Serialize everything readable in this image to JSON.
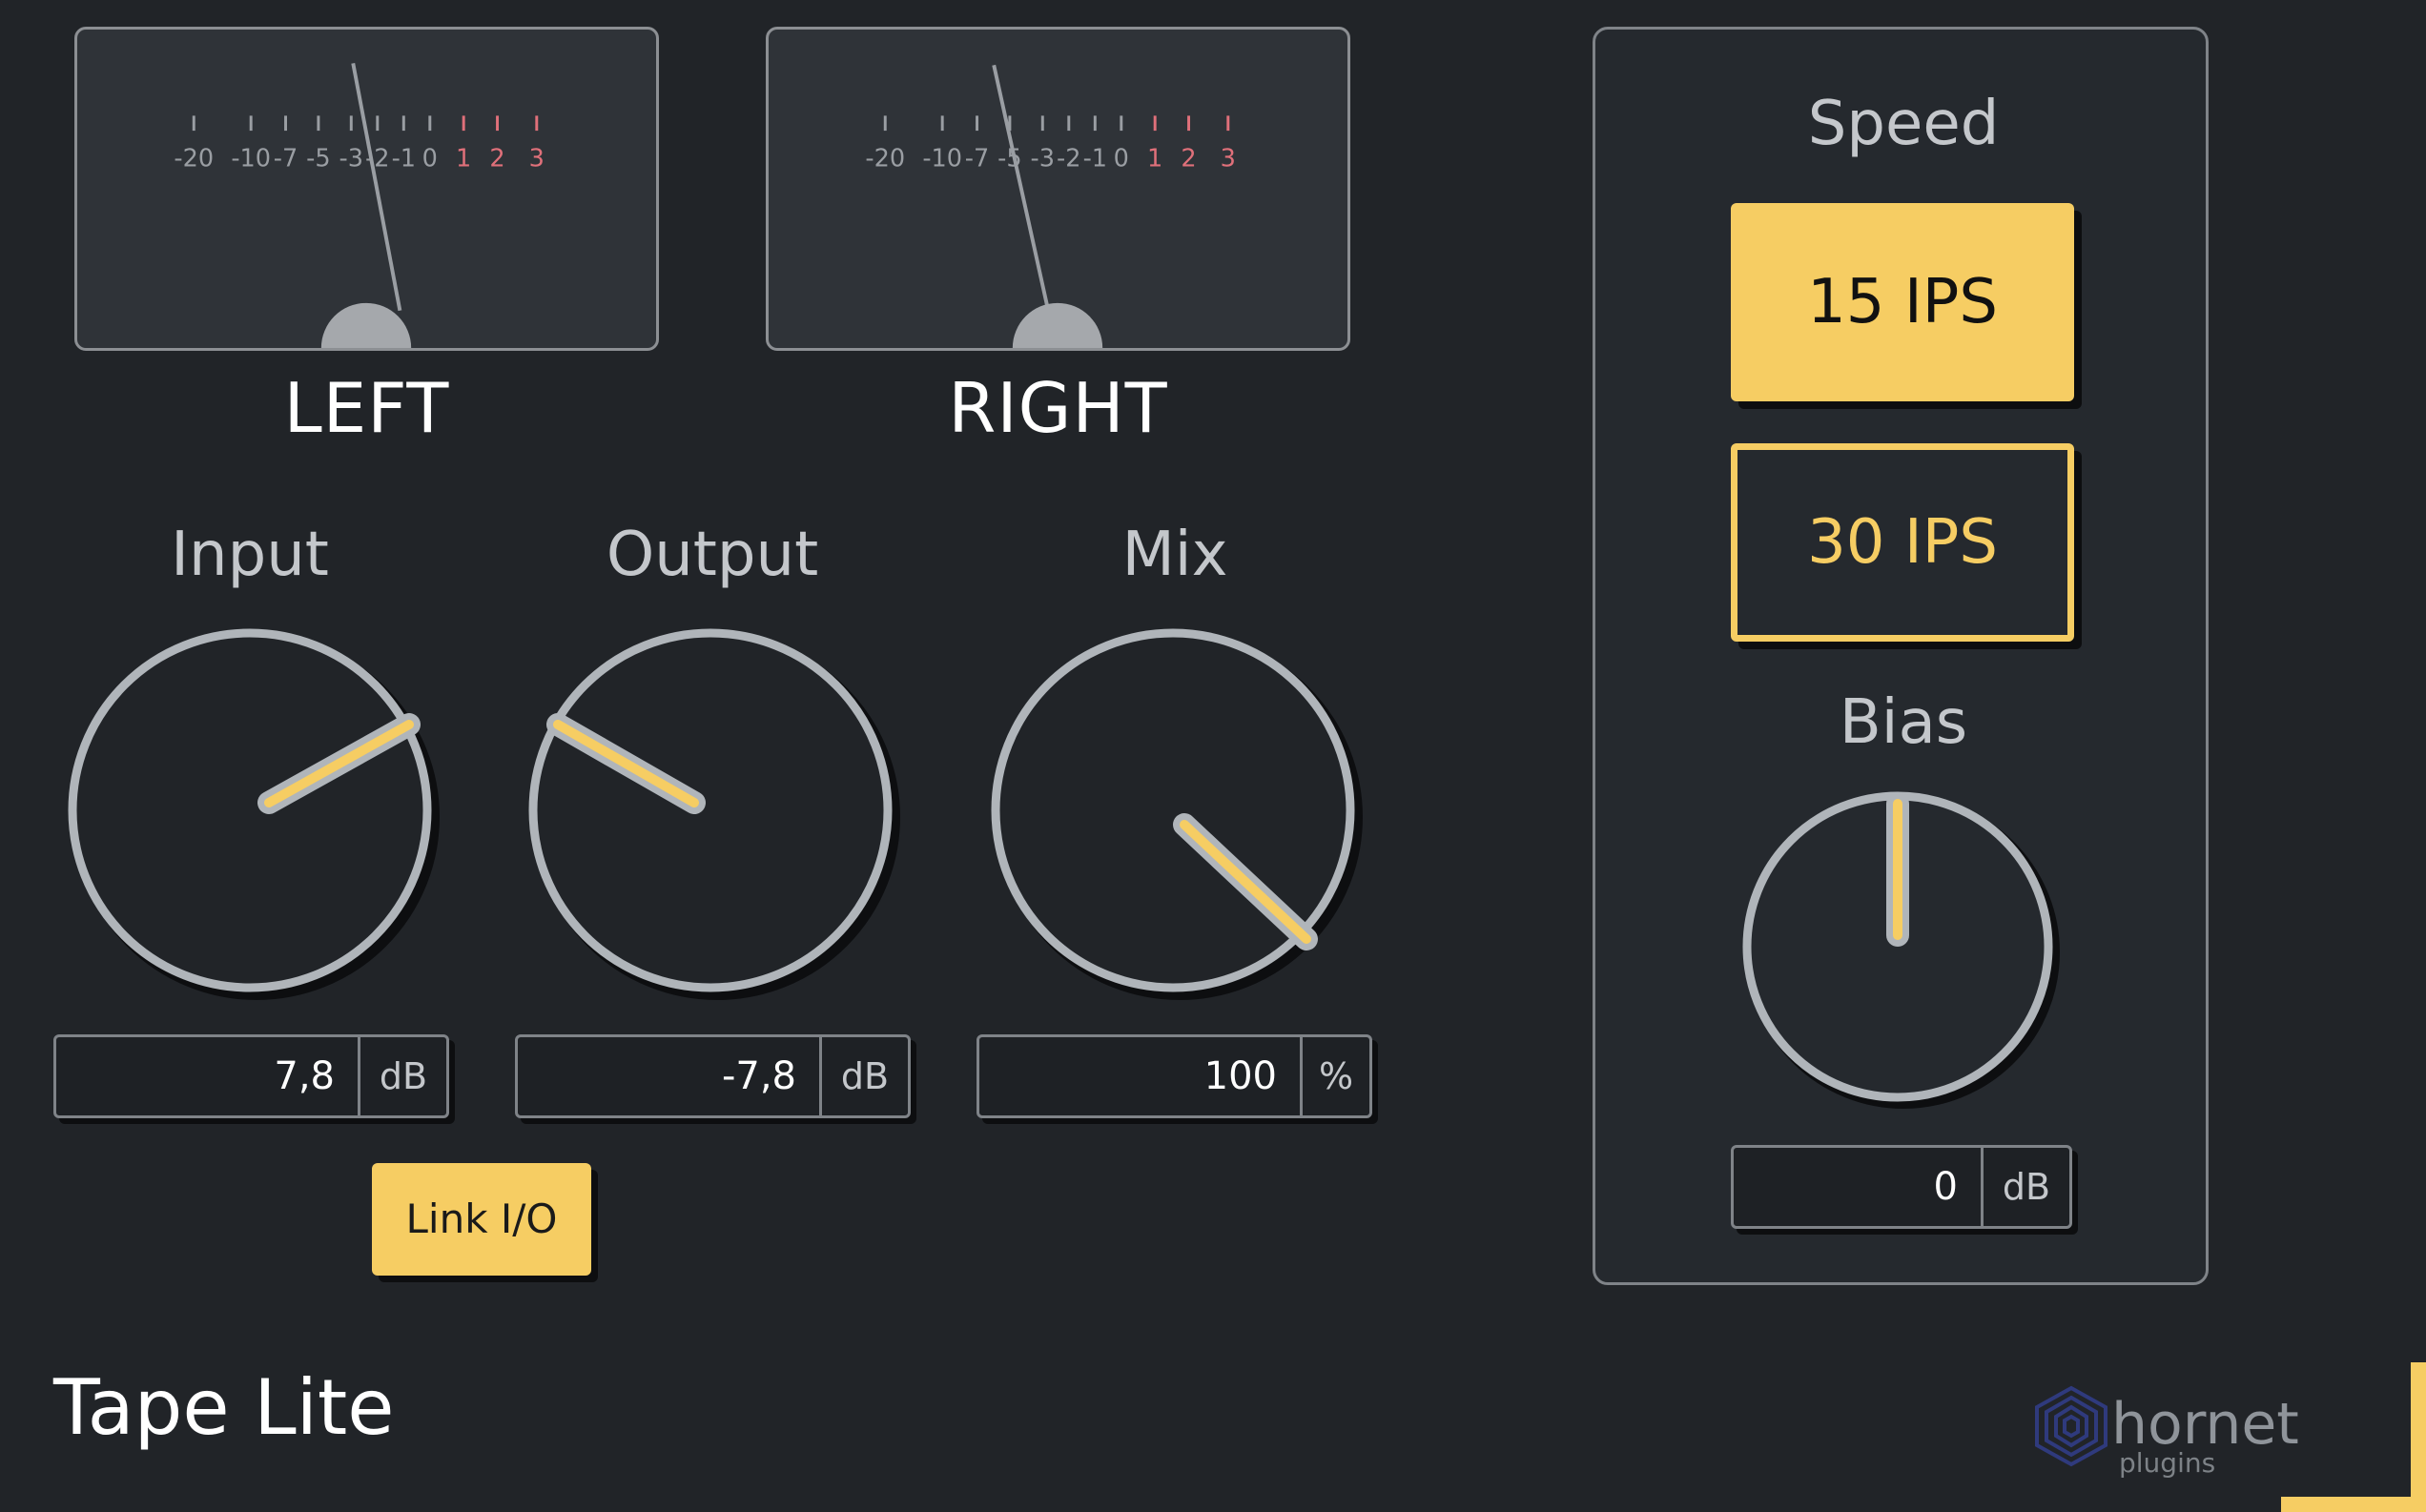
{
  "meters": {
    "scale": [
      "-20",
      "-10",
      "-7",
      "-5",
      "-3",
      "-2",
      "-1",
      "0",
      "1",
      "2",
      "3"
    ],
    "left": {
      "label": "LEFT"
    },
    "right": {
      "label": "RIGHT"
    }
  },
  "knobs": {
    "input": {
      "title": "Input",
      "value": "7,8",
      "unit": "dB"
    },
    "output": {
      "title": "Output",
      "value": "-7,8",
      "unit": "dB"
    },
    "mix": {
      "title": "Mix",
      "value": "100",
      "unit": "%"
    }
  },
  "link_button": {
    "label": "Link I/O"
  },
  "speed": {
    "title": "Speed",
    "options": [
      {
        "label": "15 IPS",
        "selected": true
      },
      {
        "label": "30 IPS",
        "selected": false
      }
    ]
  },
  "bias": {
    "title": "Bias",
    "value": "0",
    "unit": "dB"
  },
  "footer": {
    "product_name": "Tape Lite",
    "logo_text": "hornet",
    "logo_subtext": "plugins"
  },
  "colors": {
    "accent": "#f6cd63",
    "background": "#212428",
    "knob_ring": "#b0b5ba",
    "meter_red": "#e0707a"
  }
}
